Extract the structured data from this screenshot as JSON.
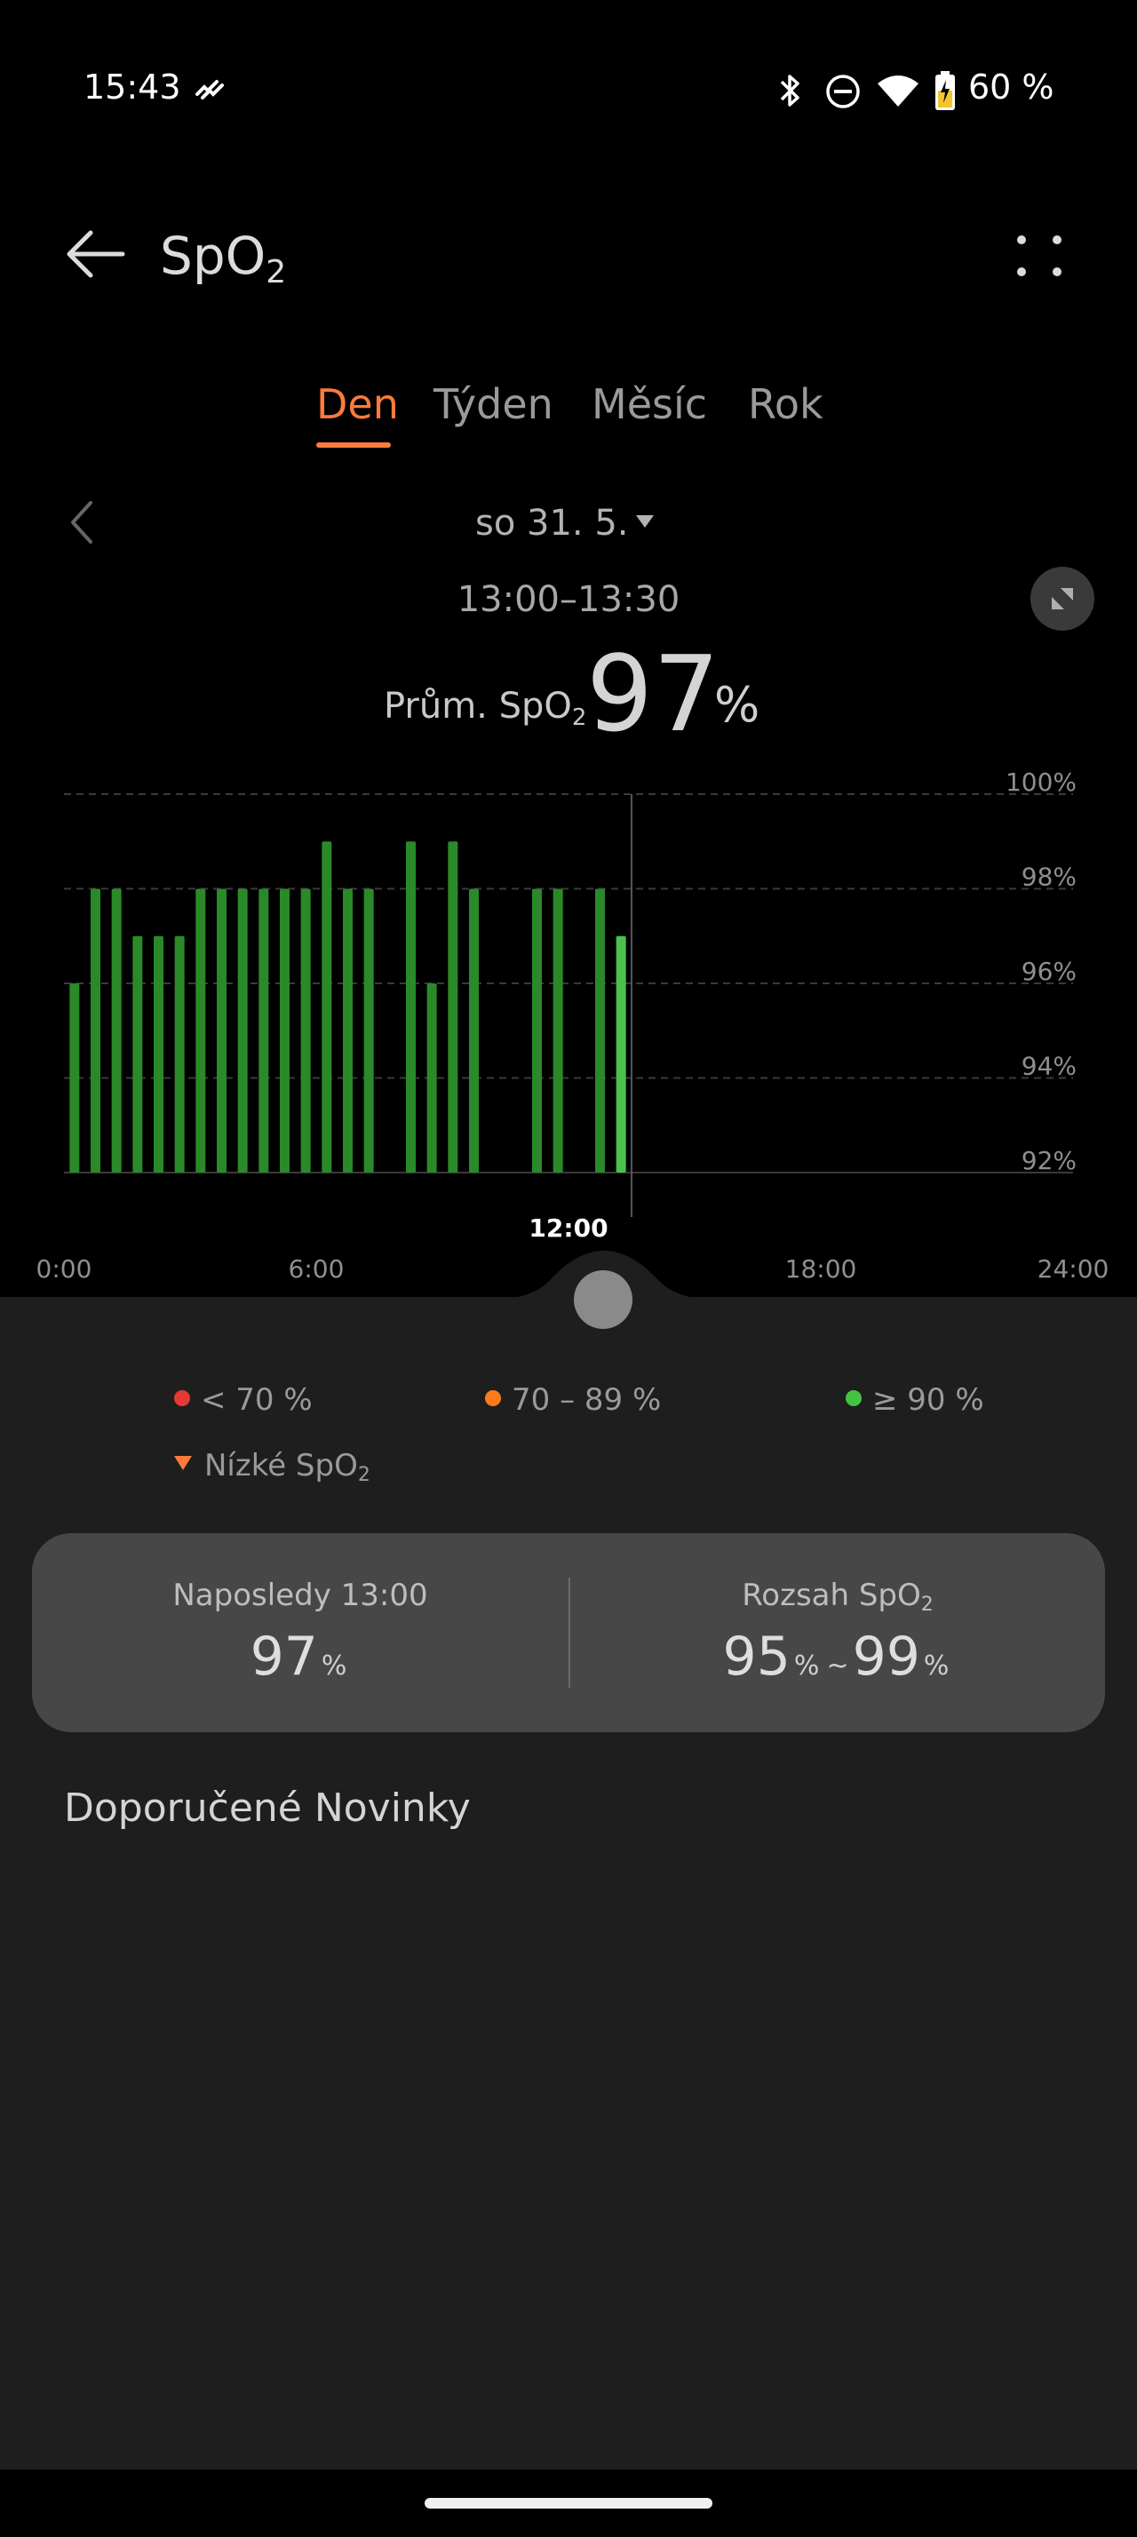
{
  "status_bar": {
    "time": "15:43",
    "battery": "60 %",
    "icons": [
      "health-sync-icon",
      "bluetooth-icon",
      "do-not-disturb-icon",
      "wifi-icon",
      "battery-charging-icon"
    ]
  },
  "header": {
    "title_main": "SpO",
    "title_sub": "2",
    "back_icon": "arrow-left-icon",
    "menu_icon": "more-icon"
  },
  "tabs": [
    {
      "label": "Den",
      "active": true
    },
    {
      "label": "Týden",
      "active": false
    },
    {
      "label": "Měsíc",
      "active": false
    },
    {
      "label": "Rok",
      "active": false
    }
  ],
  "date": {
    "label": "so 31. 5.",
    "time_range": "13:00–13:30"
  },
  "average": {
    "label_main": "Prům. SpO",
    "label_sub": "2",
    "value": "97",
    "unit": "%"
  },
  "chart_data": {
    "type": "bar",
    "x_unit": "hours",
    "xlim": [
      0,
      24
    ],
    "ylim": [
      92,
      100
    ],
    "y_ticks": [
      "100%",
      "98%",
      "96%",
      "94%",
      "92%"
    ],
    "x_ticks": [
      "0:00",
      "6:00",
      "12:00",
      "18:00",
      "24:00"
    ],
    "selected_x_label": "12:00",
    "selected_hour": 13.5,
    "x": [
      0.25,
      0.75,
      1.25,
      1.75,
      2.25,
      2.75,
      3.25,
      3.75,
      4.25,
      4.75,
      5.25,
      5.75,
      6.25,
      6.75,
      7.25,
      8.25,
      8.75,
      9.25,
      9.75,
      11.25,
      11.75,
      12.75,
      13.25
    ],
    "values": [
      96,
      98,
      98,
      97,
      97,
      97,
      98,
      98,
      98,
      98,
      98,
      98,
      99,
      98,
      98,
      99,
      96,
      99,
      98,
      98,
      98,
      98,
      97
    ],
    "colors": {
      "bar": "#2a8a2a",
      "selected": "#4cc24c",
      "grid": "#3a3a3a",
      "label": "#8f8f8f"
    }
  },
  "legend": [
    {
      "label": "< 70 %",
      "color": "#e53935"
    },
    {
      "label": "70 – 89 %",
      "color": "#ff7a1a"
    },
    {
      "label": "≥ 90 %",
      "color": "#43c443"
    }
  ],
  "legend_low": {
    "label_main": "Nízké SpO",
    "label_sub": "2"
  },
  "stats": {
    "last_label": "Naposledy 13:00",
    "last_value": "97",
    "last_unit": "%",
    "range_label_main": "Rozsah SpO",
    "range_label_sub": "2",
    "range_min": "95",
    "range_max": "99",
    "range_unit": "%",
    "range_sep": "~"
  },
  "recommended": {
    "title": "Doporučené Novinky"
  }
}
